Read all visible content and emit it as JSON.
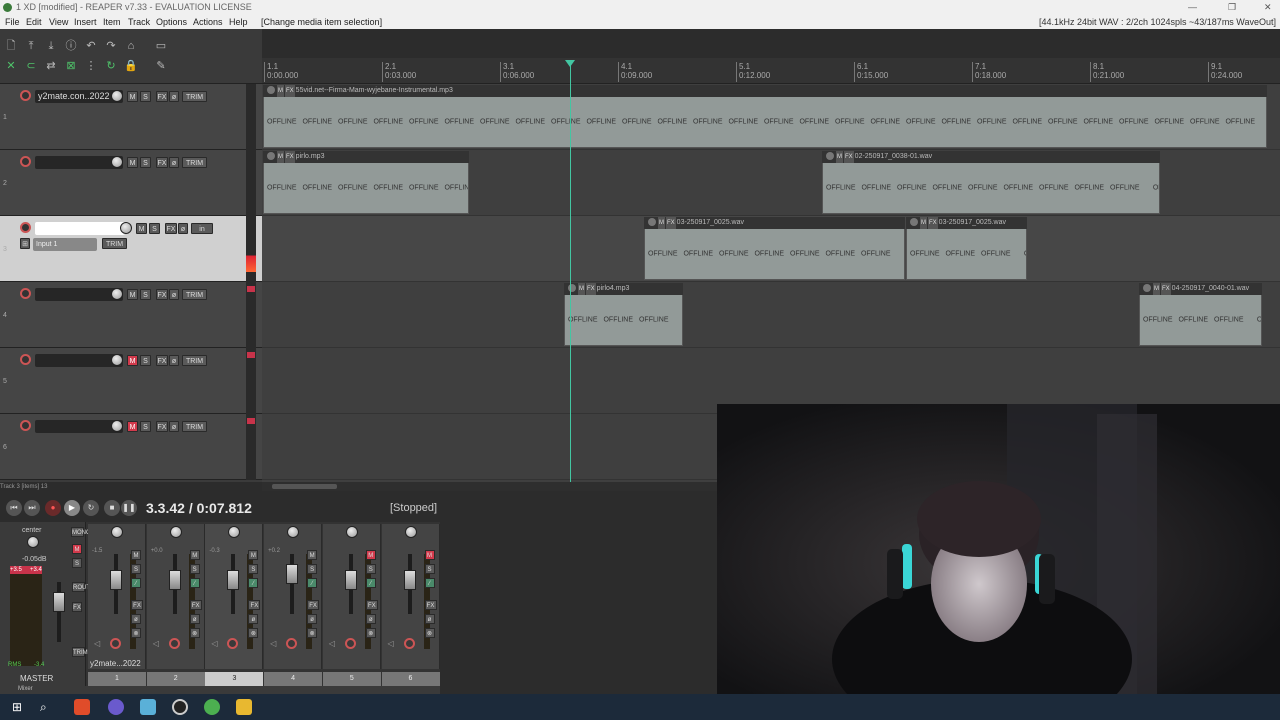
{
  "window": {
    "title": "1 XD [modified] - REAPER v7.33 - EVALUATION LICENSE",
    "status": "[44.1kHz 24bit WAV : 2/2ch 1024spls ~43/187ms WaveOut]"
  },
  "menu": {
    "items": [
      "File",
      "Edit",
      "View",
      "Insert",
      "Item",
      "Track",
      "Options",
      "Actions",
      "Help"
    ],
    "context": "[Change media item selection]"
  },
  "ruler": {
    "marks": [
      {
        "bar": "1.1",
        "time": "0:00.000"
      },
      {
        "bar": "2.1",
        "time": "0:03.000"
      },
      {
        "bar": "3.1",
        "time": "0:06.000"
      },
      {
        "bar": "4.1",
        "time": "0:09.000"
      },
      {
        "bar": "5.1",
        "time": "0:12.000"
      },
      {
        "bar": "6.1",
        "time": "0:15.000"
      },
      {
        "bar": "7.1",
        "time": "0:18.000"
      },
      {
        "bar": "8.1",
        "time": "0:21.000"
      },
      {
        "bar": "9.1",
        "time": "0:24.000"
      }
    ]
  },
  "tracks": [
    {
      "num": "1",
      "name": "y2mate.con..2022",
      "muted": false
    },
    {
      "num": "2",
      "name": "",
      "muted": false
    },
    {
      "num": "3",
      "name": "",
      "muted": false,
      "input": "Input 1",
      "selected": true
    },
    {
      "num": "4",
      "name": "",
      "muted": false
    },
    {
      "num": "5",
      "name": "",
      "muted": true
    },
    {
      "num": "6",
      "name": "",
      "muted": true
    }
  ],
  "buttons": {
    "mute": "M",
    "solo": "S",
    "fx": "FX",
    "trim": "TRIM",
    "phase": "ø",
    "in": "in"
  },
  "items": [
    {
      "name": "55vid.net--Firma-Mam-wyjebane-Instrumental.mp3",
      "offline_count": 28,
      "tail": "OF..."
    },
    {
      "name": "pirlo.mp3",
      "offline_count": 6,
      "tail": ""
    },
    {
      "name": "02-250917_0038-01.wav",
      "offline_count": 9,
      "tail": "OF..."
    },
    {
      "name": "03-250917_0025.wav",
      "offline_count": 7,
      "tail": "OF..."
    },
    {
      "name": "03-250917_0025.wav",
      "offline_count": 3,
      "tail": "OF..."
    },
    {
      "name": "pirlo4.mp3",
      "offline_count": 3,
      "tail": "O..."
    },
    {
      "name": "04-250917_0040-01.wav",
      "offline_count": 3,
      "tail": "OF..."
    }
  ],
  "offline_label": "OFFLINE",
  "status_track": "Track 3 [items] 13",
  "transport": {
    "time": "3.3.42 / 0:07.812",
    "state": "[Stopped]"
  },
  "master": {
    "label": "MASTER",
    "pan": "center",
    "volume": "-0.05dB",
    "peak_l": "+3.5",
    "peak_r": "+3.4",
    "rms": "RMS",
    "rms_val": "-3.4",
    "mono": "MONO",
    "route": "ROUTE"
  },
  "mixer": {
    "strips": [
      {
        "num": "1",
        "vol": "-1.5",
        "name": "y2mate...2022"
      },
      {
        "num": "2",
        "vol": "+0.0",
        "name": ""
      },
      {
        "num": "3",
        "vol": "-0.3",
        "name": ""
      },
      {
        "num": "4",
        "vol": "+0.2",
        "name": ""
      },
      {
        "num": "5",
        "vol": "",
        "name": ""
      },
      {
        "num": "6",
        "vol": "",
        "name": ""
      }
    ],
    "tab": "Mixer"
  }
}
